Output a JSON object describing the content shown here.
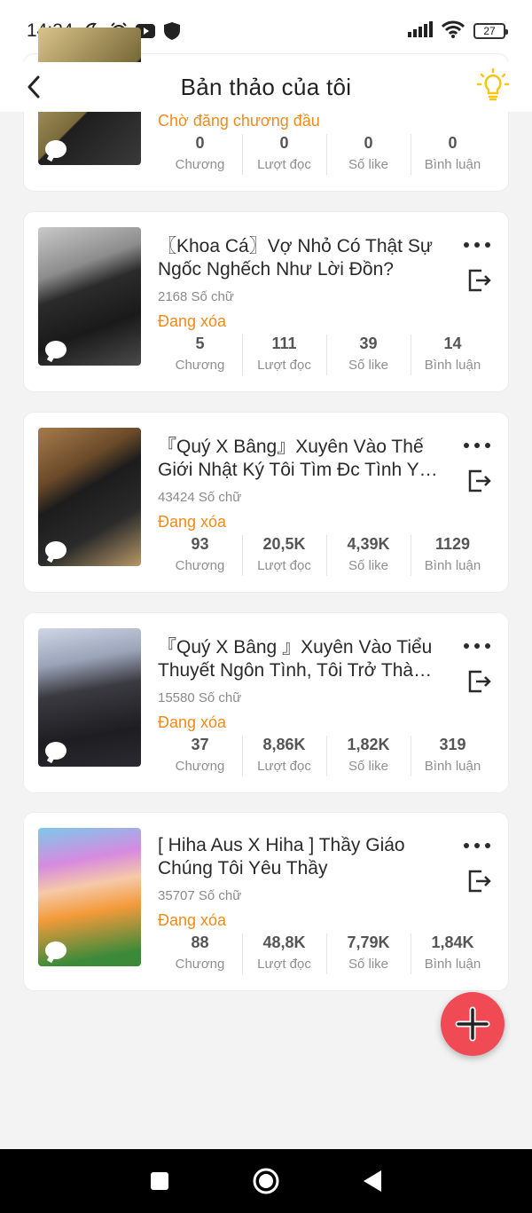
{
  "status_bar": {
    "time": "14:34",
    "battery": "27"
  },
  "header": {
    "title": "Bản thảo của tôi"
  },
  "labels": {
    "chapters": "Chương",
    "reads": "Lượt đọc",
    "likes": "Số like",
    "comments": "Bình luận"
  },
  "cards": [
    {
      "title": "",
      "word_count": "",
      "status": "Chờ đăng chương đầu",
      "chapters": "0",
      "reads": "0",
      "likes": "0",
      "comments": "0"
    },
    {
      "title": "〖Khoa Cá〗Vợ Nhỏ Có Thật Sự Ngốc Nghếch Như Lời Đồn?",
      "word_count": "2168 Số chữ",
      "status": "Đang xóa",
      "chapters": "5",
      "reads": "111",
      "likes": "39",
      "comments": "14"
    },
    {
      "title": "『Quý X Bâng』Xuyên Vào Thế Giới Nhật Ký Tôi Tìm Đc Tình Y…",
      "word_count": "43424 Số chữ",
      "status": "Đang xóa",
      "chapters": "93",
      "reads": "20,5K",
      "likes": "4,39K",
      "comments": "1129"
    },
    {
      "title": "『Quý X Bâng 』Xuyên Vào Tiểu Thuyết Ngôn Tình, Tôi Trở Thà…",
      "word_count": "15580 Số chữ",
      "status": "Đang xóa",
      "chapters": "37",
      "reads": "8,86K",
      "likes": "1,82K",
      "comments": "319"
    },
    {
      "title": "[ Hiha Aus X Hiha ] Thầy Giáo Chúng Tôi Yêu Thầy",
      "word_count": "35707 Số chữ",
      "status": "Đang xóa",
      "chapters": "88",
      "reads": "48,8K",
      "likes": "7,79K",
      "comments": "1,84K"
    }
  ],
  "colors": {
    "accent_orange": "#f08a1c",
    "fab_red": "#f04a55",
    "bulb_yellow": "#f5c518"
  }
}
